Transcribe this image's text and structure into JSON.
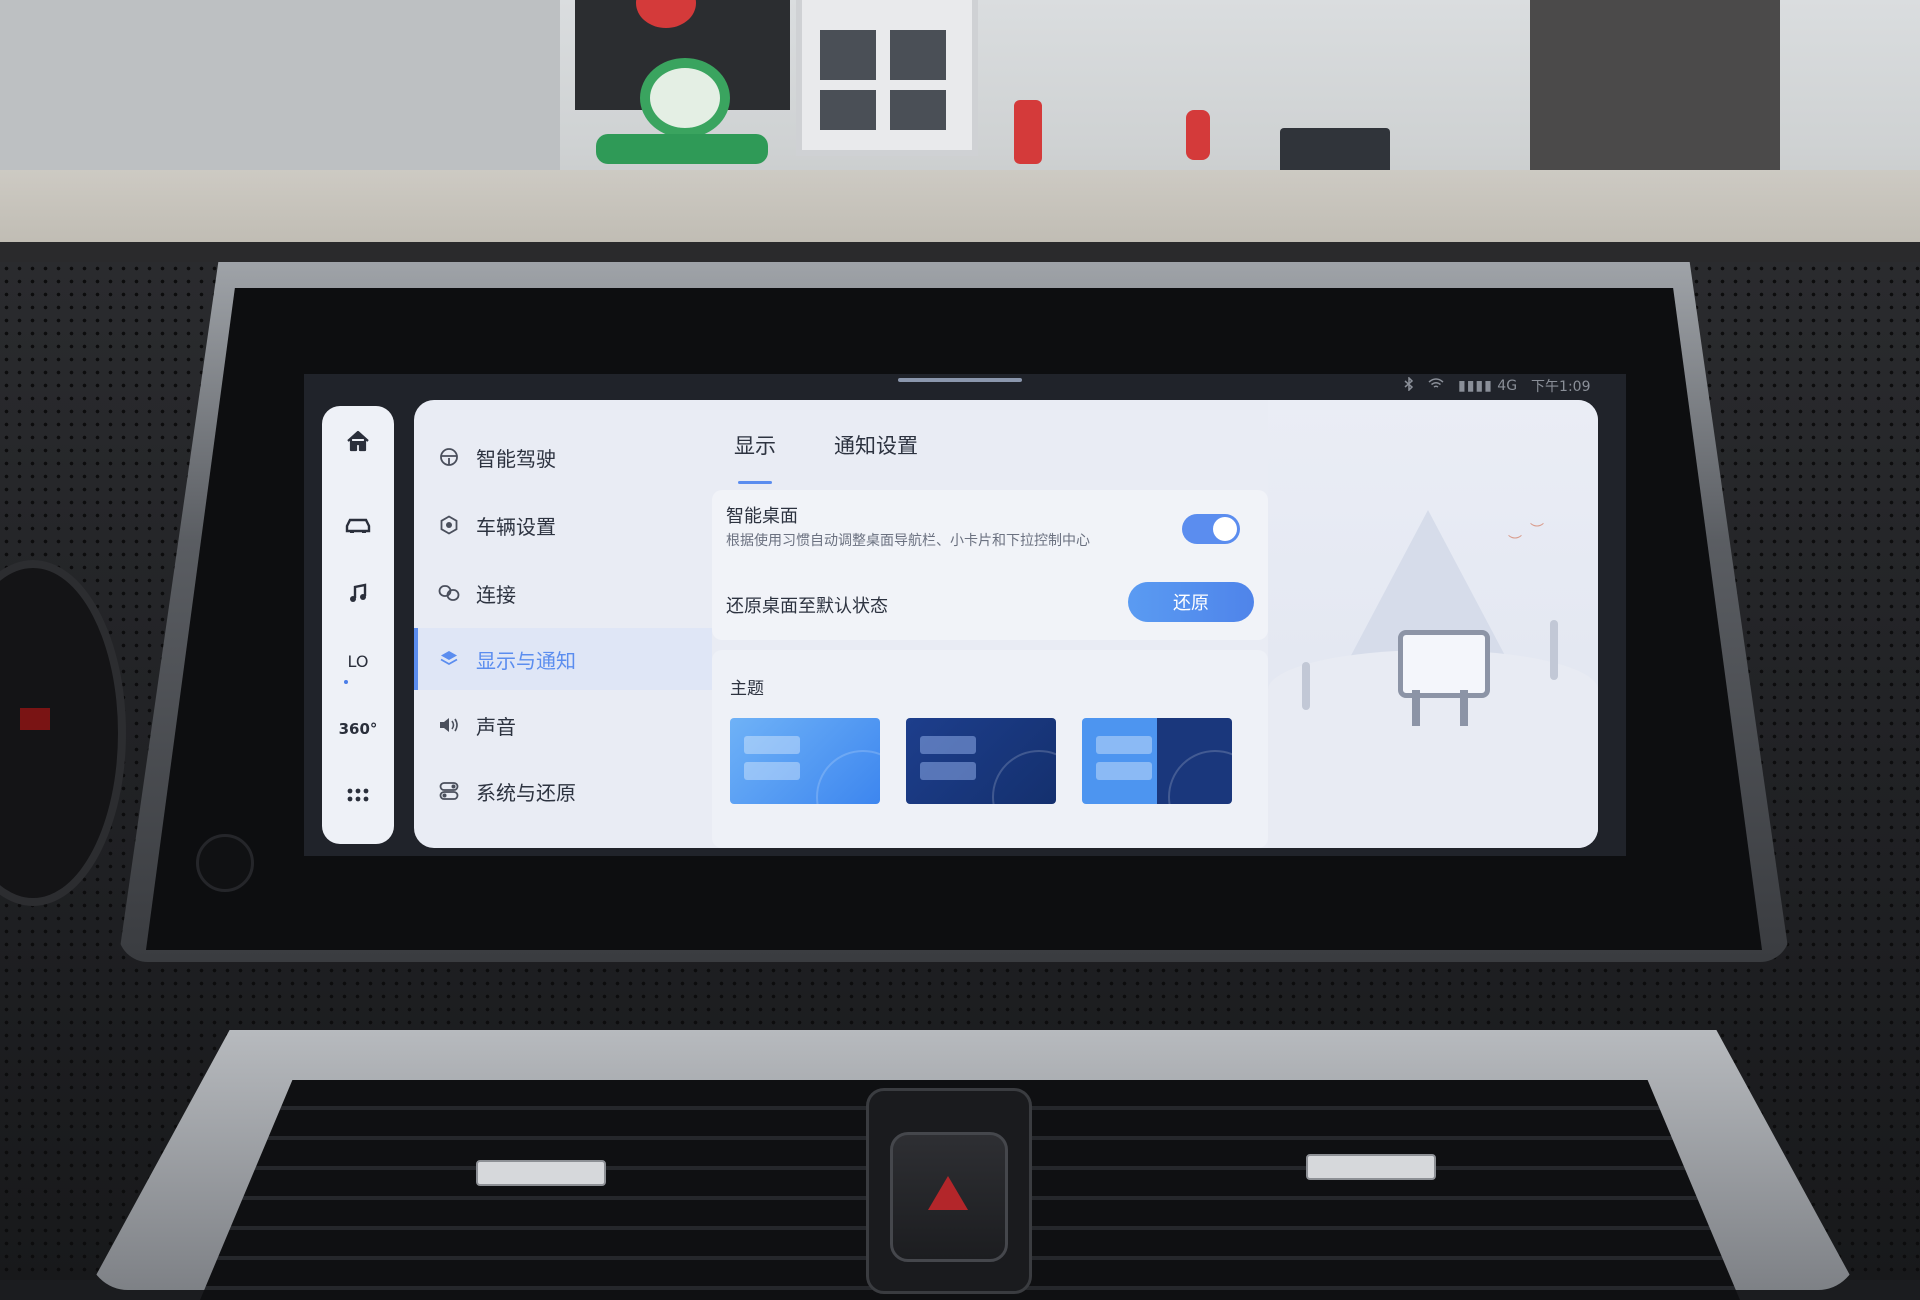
{
  "statusbar": {
    "bluetooth_icon": "bluetooth-icon",
    "wifi_icon": "wifi-icon",
    "signal": "4G",
    "time": "下午1:09"
  },
  "rail": {
    "items": [
      {
        "icon": "home-icon"
      },
      {
        "icon": "car-icon"
      },
      {
        "icon": "music-icon"
      },
      {
        "label": "LO"
      },
      {
        "label": "360°"
      },
      {
        "icon": "apps-grid-icon"
      }
    ]
  },
  "menu": {
    "items": [
      {
        "label": "智能驾驶",
        "icon": "steering-wheel-icon"
      },
      {
        "label": "车辆设置",
        "icon": "hexagon-settings-icon"
      },
      {
        "label": "连接",
        "icon": "link-icon"
      },
      {
        "label": "显示与通知",
        "icon": "layers-icon",
        "active": true
      },
      {
        "label": "声音",
        "icon": "speaker-icon"
      },
      {
        "label": "系统与还原",
        "icon": "toggles-icon"
      }
    ]
  },
  "tabs": {
    "display": "显示",
    "notify": "通知设置",
    "active": "显示"
  },
  "smart_desktop": {
    "title": "智能桌面",
    "description": "根据使用习惯自动调整桌面导航栏、小卡片和下拉控制中心",
    "enabled": true
  },
  "restore": {
    "label": "还原桌面至默认状态",
    "button": "还原"
  },
  "theme": {
    "label": "主题",
    "options": [
      {
        "name": "light-blue"
      },
      {
        "name": "dark-blue"
      },
      {
        "name": "split-blue"
      }
    ]
  },
  "colors": {
    "accent": "#5b8def",
    "panel": "#e9ecf4",
    "text": "#2d3340"
  }
}
